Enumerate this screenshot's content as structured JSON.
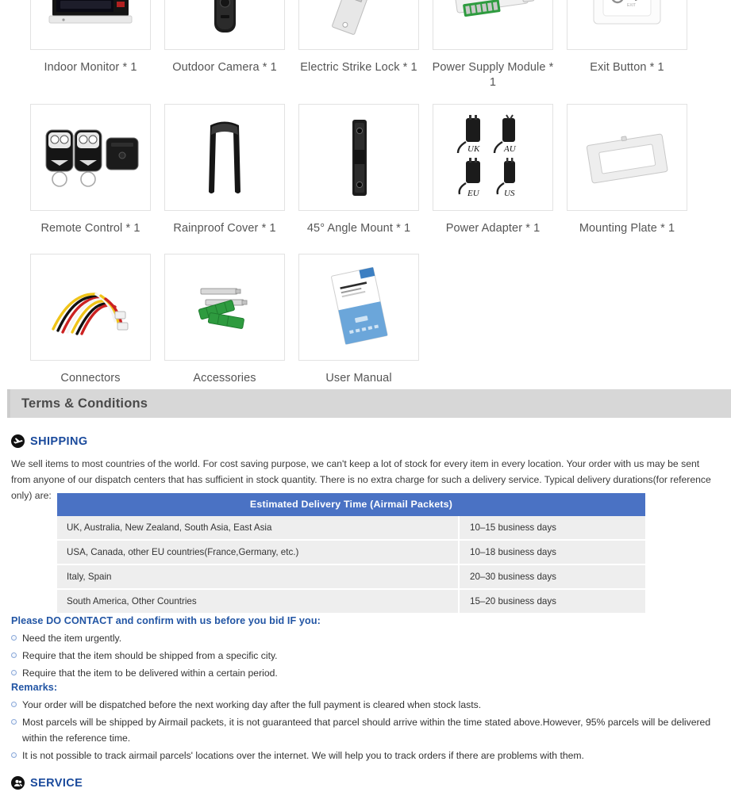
{
  "products": {
    "rows": [
      [
        {
          "label": "Indoor Monitor * 1",
          "icon": "indoor-monitor-image"
        },
        {
          "label": "Outdoor Camera * 1",
          "icon": "outdoor-camera-image"
        },
        {
          "label": "Electric Strike Lock * 1",
          "icon": "electric-strike-lock-image"
        },
        {
          "label": "Power Supply Module * 1",
          "icon": "power-supply-module-image"
        },
        {
          "label": "Exit Button * 1",
          "icon": "exit-button-image"
        }
      ],
      [
        {
          "label": "Remote Control * 1",
          "icon": "remote-control-image"
        },
        {
          "label": "Rainproof Cover * 1",
          "icon": "rainproof-cover-image"
        },
        {
          "label": "45° Angle Mount * 1",
          "icon": "angle-mount-image"
        },
        {
          "label": "Power Adapter * 1",
          "icon": "power-adapter-image"
        },
        {
          "label": "Mounting Plate * 1",
          "icon": "mounting-plate-image"
        }
      ],
      [
        {
          "label": "Connectors",
          "icon": "connectors-image"
        },
        {
          "label": "Accessories",
          "icon": "accessories-image"
        },
        {
          "label": "User Manual",
          "icon": "user-manual-image"
        }
      ]
    ],
    "adapter_labels": [
      "UK",
      "AU",
      "EU",
      "US"
    ]
  },
  "terms": {
    "banner_title": "Terms & Conditions"
  },
  "shipping": {
    "icon": "airplane-icon",
    "heading": "SHIPPING",
    "paragraph": "We sell items to most countries of the world. For cost saving purpose, we can't keep a lot of stock for every item in every location. Your order with us may be sent from anyone of our dispatch centers that has sufficient in stock quantity. There is no extra charge for such a delivery service. Typical delivery durations(for reference only) are:",
    "table": {
      "header": "Estimated Delivery Time (Airmail Packets)",
      "rows": [
        {
          "region": "UK, Australia, New Zealand, South Asia, East Asia",
          "time": "10–15 business days"
        },
        {
          "region": "USA, Canada, other EU countries(France,Germany, etc.)",
          "time": "10–18 business days"
        },
        {
          "region": "Italy, Spain",
          "time": "20–30 business days"
        },
        {
          "region": "South America, Other Countries",
          "time": "15–20 business days"
        }
      ]
    },
    "contact_heading": "Please DO CONTACT and confirm with us before you bid IF you:",
    "contact_items": [
      "Need the item urgently.",
      "Require that the item should be shipped from a specific city.",
      "Require that the item to be delivered within a certain period."
    ],
    "remarks_heading": "Remarks:",
    "remarks_items": [
      "Your order will be dispatched before the next working day after the full payment is cleared when stock lasts.",
      "Most parcels will be shipped by Airmail packets, it is not guaranteed that parcel should arrive within the time stated above.However, 95% parcels will be delivered within the reference time.",
      "It is not possible to track airmail parcels' locations over the internet. We will help you to track orders if there are problems with them."
    ]
  },
  "service": {
    "icon": "users-icon",
    "heading": "SERVICE"
  },
  "colors": {
    "banner_bg": "#d7d7d7",
    "table_header_bg": "#4a72c4",
    "table_row_bg": "#eeeeee",
    "heading_blue": "#1a4a9c",
    "bullet_blue": "#8aa8d8"
  }
}
